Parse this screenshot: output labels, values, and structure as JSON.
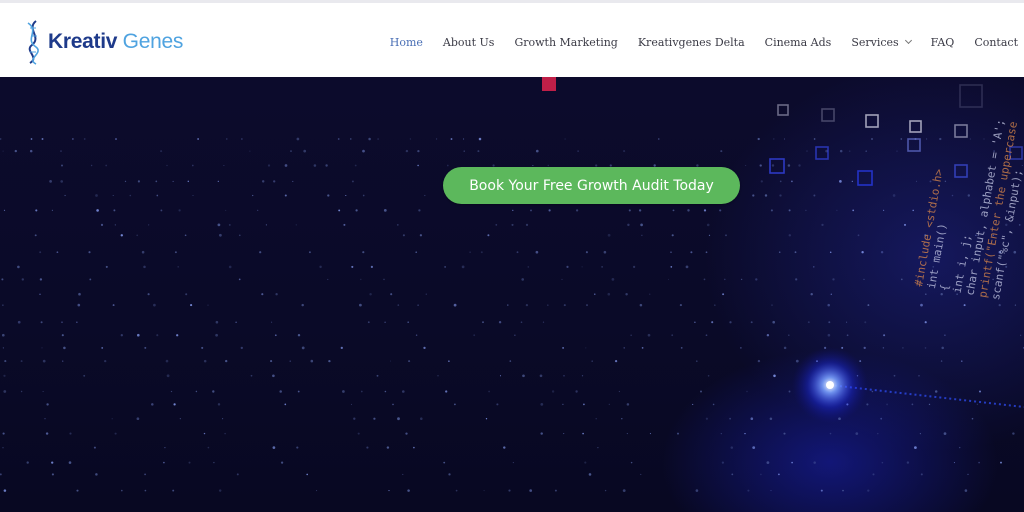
{
  "logo": {
    "word1": "Kreativ",
    "word2": "Genes"
  },
  "nav": {
    "items": [
      {
        "label": "Home",
        "active": true
      },
      {
        "label": "About Us"
      },
      {
        "label": "Growth Marketing"
      },
      {
        "label": "Kreativgenes Delta"
      },
      {
        "label": "Cinema Ads"
      },
      {
        "label": "Services",
        "has_dropdown": true
      },
      {
        "label": "FAQ"
      },
      {
        "label": "Contact"
      }
    ]
  },
  "hero": {
    "cta_label": "Book Your Free Growth Audit Today",
    "code_lines": [
      "#include <stdio.h>",
      "int main()",
      "{",
      "    int i, j;",
      "    char input, alphabet = 'A';",
      "    printf(\"Enter the uppercase",
      "    scanf(\"%c\", &input);"
    ]
  },
  "colors": {
    "brand_dark": "#1e3a8a",
    "brand_light": "#4fa3e0",
    "nav_active": "#4a6fb5",
    "cta": "#5cb85c",
    "hero_bg": "#0b0a2a"
  }
}
